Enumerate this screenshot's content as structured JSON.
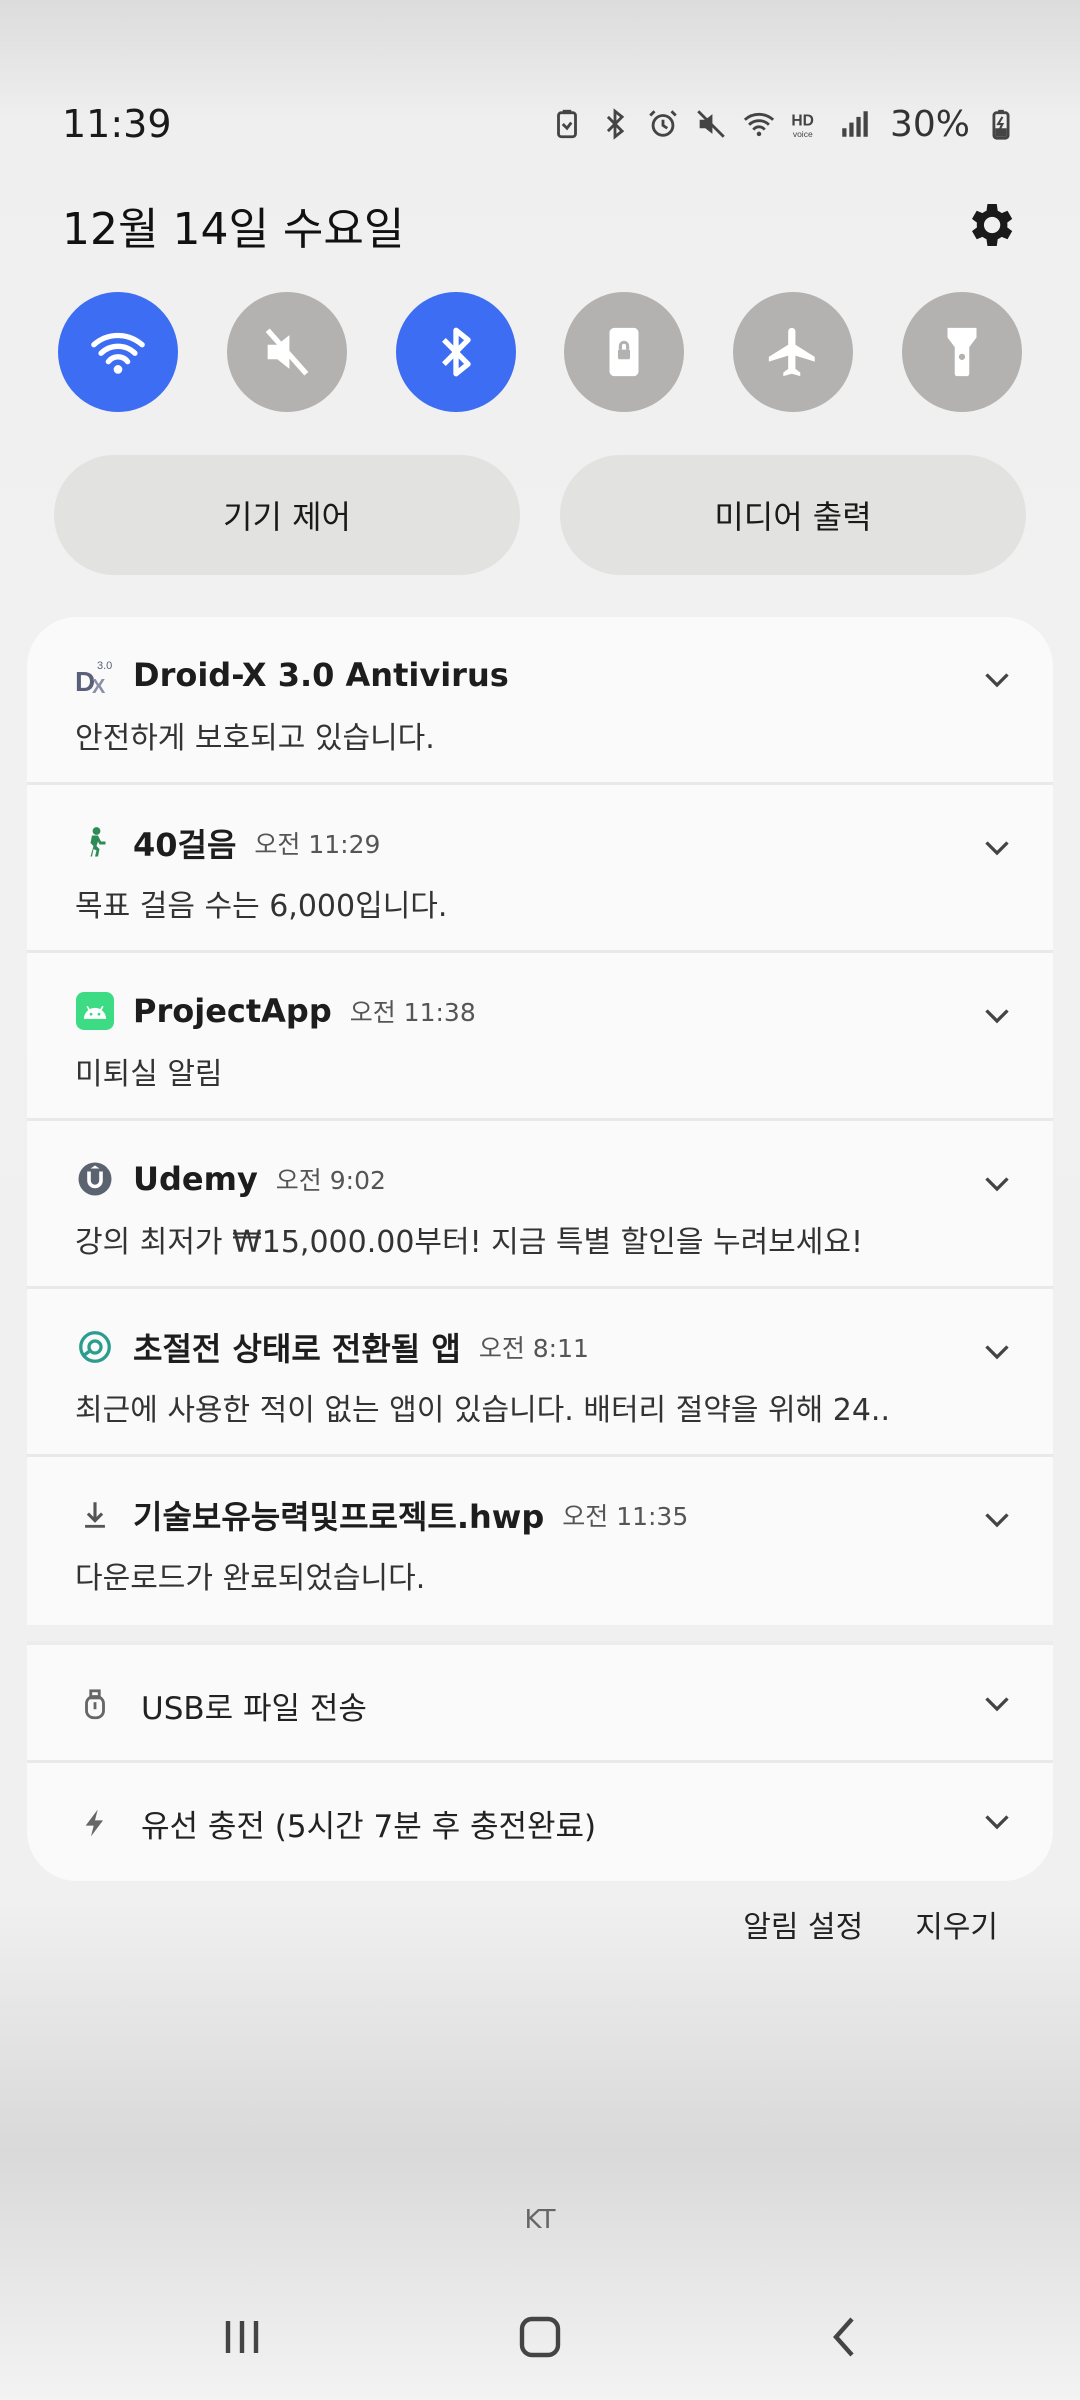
{
  "status_bar": {
    "time": "11:39",
    "battery": "30%",
    "icons": [
      "battery-saver-icon",
      "bluetooth-icon",
      "alarm-icon",
      "mute-icon",
      "wifi-icon",
      "hd-voice-icon",
      "signal-icon",
      "charging-battery-icon"
    ]
  },
  "header": {
    "date": "12월 14일 수요일"
  },
  "quick_settings": [
    {
      "name": "wifi",
      "state": "on"
    },
    {
      "name": "sound",
      "state": "muted"
    },
    {
      "name": "bluetooth",
      "state": "on"
    },
    {
      "name": "screen-lock",
      "state": "off"
    },
    {
      "name": "airplane-mode",
      "state": "off"
    },
    {
      "name": "flashlight",
      "state": "off"
    }
  ],
  "pills": {
    "device_control": "기기 제어",
    "media_output": "미디어 출력"
  },
  "notifications": [
    {
      "app": "Droid-X 3.0 Antivirus",
      "time": "",
      "body": "안전하게 보호되고 있습니다."
    },
    {
      "app": "40걸음",
      "time": "오전 11:29",
      "body": "목표 걸음 수는 6,000입니다."
    },
    {
      "app": "ProjectApp",
      "time": "오전 11:38",
      "body": "미퇴실 알림"
    },
    {
      "app": "Udemy",
      "time": "오전 9:02",
      "body": "강의 최저가 ₩15,000.00부터! 지금 특별 할인을 누려보세요!"
    },
    {
      "app": "초절전 상태로 전환될 앱",
      "time": "오전 8:11",
      "body": "최근에 사용한 적이 없는 앱이 있습니다. 배터리 절약을 위해 24.."
    },
    {
      "app": "기술보유능력및프로젝트.hwp",
      "time": "오전 11:35",
      "body": "다운로드가 완료되었습니다."
    }
  ],
  "system_notifications": [
    {
      "label": "USB로 파일 전송"
    },
    {
      "label": "유선 충전 (5시간 7분 후 충전완료)"
    }
  ],
  "actions": {
    "notification_settings": "알림 설정",
    "clear": "지우기"
  },
  "carrier": "KT",
  "colors": {
    "accent": "#3d6df2",
    "tile_off": "#b3b2b0",
    "pill_bg": "#e2e2e0"
  }
}
